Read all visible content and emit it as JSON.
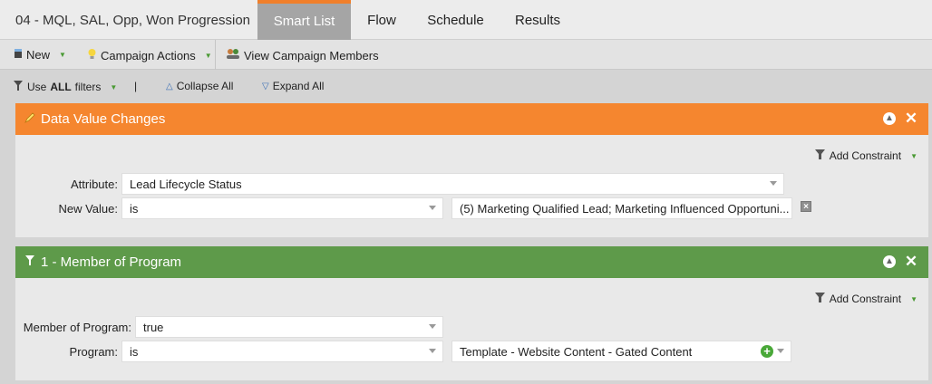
{
  "header": {
    "program_title": "04 - MQL, SAL, Opp, Won Progression",
    "tabs": [
      {
        "label": "Smart List",
        "active": true
      },
      {
        "label": "Flow",
        "active": false
      },
      {
        "label": "Schedule",
        "active": false
      },
      {
        "label": "Results",
        "active": false
      }
    ]
  },
  "toolbar": {
    "new_label": "New",
    "campaign_actions_label": "Campaign Actions",
    "view_members_label": "View Campaign Members"
  },
  "filterbar": {
    "use_prefix": "Use",
    "use_strong": "ALL",
    "use_suffix": "filters",
    "separator": "|",
    "collapse_label": "Collapse All",
    "expand_label": "Expand All"
  },
  "filters": [
    {
      "title": "Data Value Changes",
      "color": "#f5862f",
      "add_constraint_label": "Add Constraint",
      "rows": [
        {
          "label": "Attribute:",
          "value": "Lead Lifecycle Status"
        },
        {
          "label": "New Value:",
          "operator": "is",
          "value": "(5) Marketing Qualified Lead; Marketing Influenced Opportuni..."
        }
      ]
    },
    {
      "title": "1 - Member of Program",
      "color": "#5e9a4a",
      "add_constraint_label": "Add Constraint",
      "rows": [
        {
          "label": "Member of Program:",
          "value": "true"
        },
        {
          "label": "Program:",
          "operator": "is",
          "value": "Template - Website Content - Gated Content"
        }
      ]
    }
  ],
  "colors": {
    "accent_orange": "#f07f2a",
    "tab_active_bg": "#a5a5a5",
    "green_triangle": "#4a9a34"
  }
}
